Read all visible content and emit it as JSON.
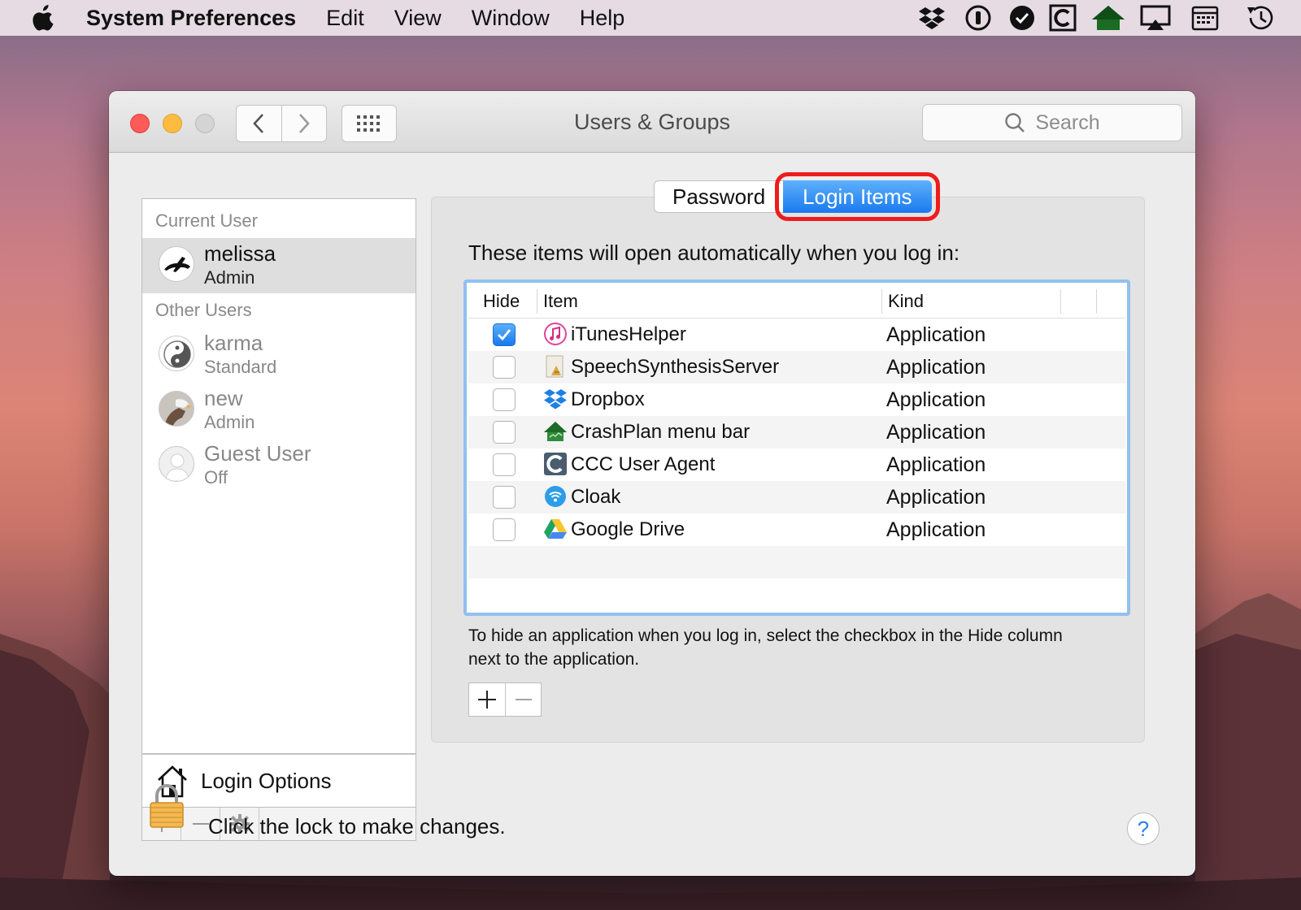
{
  "menubar": {
    "app_name": "System Preferences",
    "items": [
      "Edit",
      "View",
      "Window",
      "Help"
    ],
    "status_icons": [
      "dropbox-icon",
      "1password-icon",
      "check-circle-icon",
      "ccc-icon",
      "crashplan-icon",
      "airplay-icon",
      "calendar-icon",
      "time-machine-icon"
    ]
  },
  "window": {
    "title": "Users & Groups",
    "search_placeholder": "Search"
  },
  "sidebar": {
    "current_user_label": "Current User",
    "other_users_label": "Other Users",
    "users": [
      {
        "name": "melissa",
        "role": "Admin",
        "avatar": "rabbit-avatar"
      },
      {
        "name": "karma",
        "role": "Standard",
        "avatar": "yin-yang-avatar"
      },
      {
        "name": "new",
        "role": "Admin",
        "avatar": "eagle-avatar"
      },
      {
        "name": "Guest User",
        "role": "Off",
        "avatar": "generic-user-avatar"
      }
    ],
    "login_options_label": "Login Options"
  },
  "tabs": {
    "password": "Password",
    "login_items": "Login Items",
    "selected": "Login Items"
  },
  "login_items": {
    "heading": "These items will open automatically when you log in:",
    "columns": {
      "hide": "Hide",
      "item": "Item",
      "kind": "Kind"
    },
    "rows": [
      {
        "hide": true,
        "name": "iTunesHelper",
        "kind": "Application",
        "icon": "itunes-icon"
      },
      {
        "hide": false,
        "name": "SpeechSynthesisServer",
        "kind": "Application",
        "icon": "speech-synthesis-icon"
      },
      {
        "hide": false,
        "name": "Dropbox",
        "kind": "Application",
        "icon": "dropbox-icon"
      },
      {
        "hide": false,
        "name": "CrashPlan menu bar",
        "kind": "Application",
        "icon": "crashplan-icon"
      },
      {
        "hide": false,
        "name": "CCC User Agent",
        "kind": "Application",
        "icon": "ccc-icon"
      },
      {
        "hide": false,
        "name": "Cloak",
        "kind": "Application",
        "icon": "cloak-icon"
      },
      {
        "hide": false,
        "name": "Google Drive",
        "kind": "Application",
        "icon": "google-drive-icon"
      }
    ],
    "hint": "To hide an application when you log in, select the checkbox in the Hide column next to the application."
  },
  "footer": {
    "lock_text": "Click the lock to make changes.",
    "help": "?"
  },
  "colors": {
    "accent": "#1a79ef",
    "highlight_ring": "#ee1c1c",
    "table_focus": "#92bff0"
  }
}
